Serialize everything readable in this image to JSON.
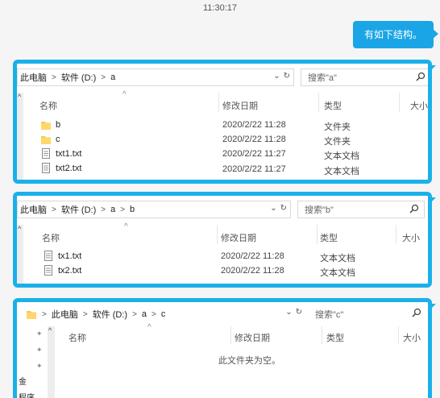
{
  "chat": {
    "time": "11:30:17",
    "message": "有如下结构。"
  },
  "win_a": {
    "crumbs": [
      "此电脑",
      "软件 (D:)",
      "a"
    ],
    "search_placeholder": "搜索\"a\"",
    "headers": {
      "name": "名称",
      "date": "修改日期",
      "type": "类型",
      "size": "大小"
    },
    "rows": [
      {
        "name": "b",
        "date": "2020/2/22 11:28",
        "type": "文件夹",
        "icon": "folder-icon"
      },
      {
        "name": "c",
        "date": "2020/2/22 11:28",
        "type": "文件夹",
        "icon": "folder-icon"
      },
      {
        "name": "txt1.txt",
        "date": "2020/2/22 11:27",
        "type": "文本文档",
        "icon": "text-file-icon"
      },
      {
        "name": "txt2.txt",
        "date": "2020/2/22 11:27",
        "type": "文本文档",
        "icon": "text-file-icon"
      }
    ]
  },
  "win_b": {
    "crumbs": [
      "此电脑",
      "软件 (D:)",
      "a",
      "b"
    ],
    "search_placeholder": "搜索\"b\"",
    "headers": {
      "name": "名称",
      "date": "修改日期",
      "type": "类型",
      "size": "大小"
    },
    "rows": [
      {
        "name": "tx1.txt",
        "date": "2020/2/22 11:28",
        "type": "文本文档",
        "icon": "text-file-icon"
      },
      {
        "name": "tx2.txt",
        "date": "2020/2/22 11:28",
        "type": "文本文档",
        "icon": "text-file-icon"
      }
    ]
  },
  "win_c": {
    "crumbs": [
      "此电脑",
      "软件 (D:)",
      "a",
      "c"
    ],
    "search_placeholder": "搜索\"c\"",
    "headers": {
      "name": "名称",
      "date": "修改日期",
      "type": "类型",
      "size": "大小"
    },
    "empty_text": "此文件夹为空。",
    "side_labels": [
      "金",
      "程序"
    ]
  }
}
